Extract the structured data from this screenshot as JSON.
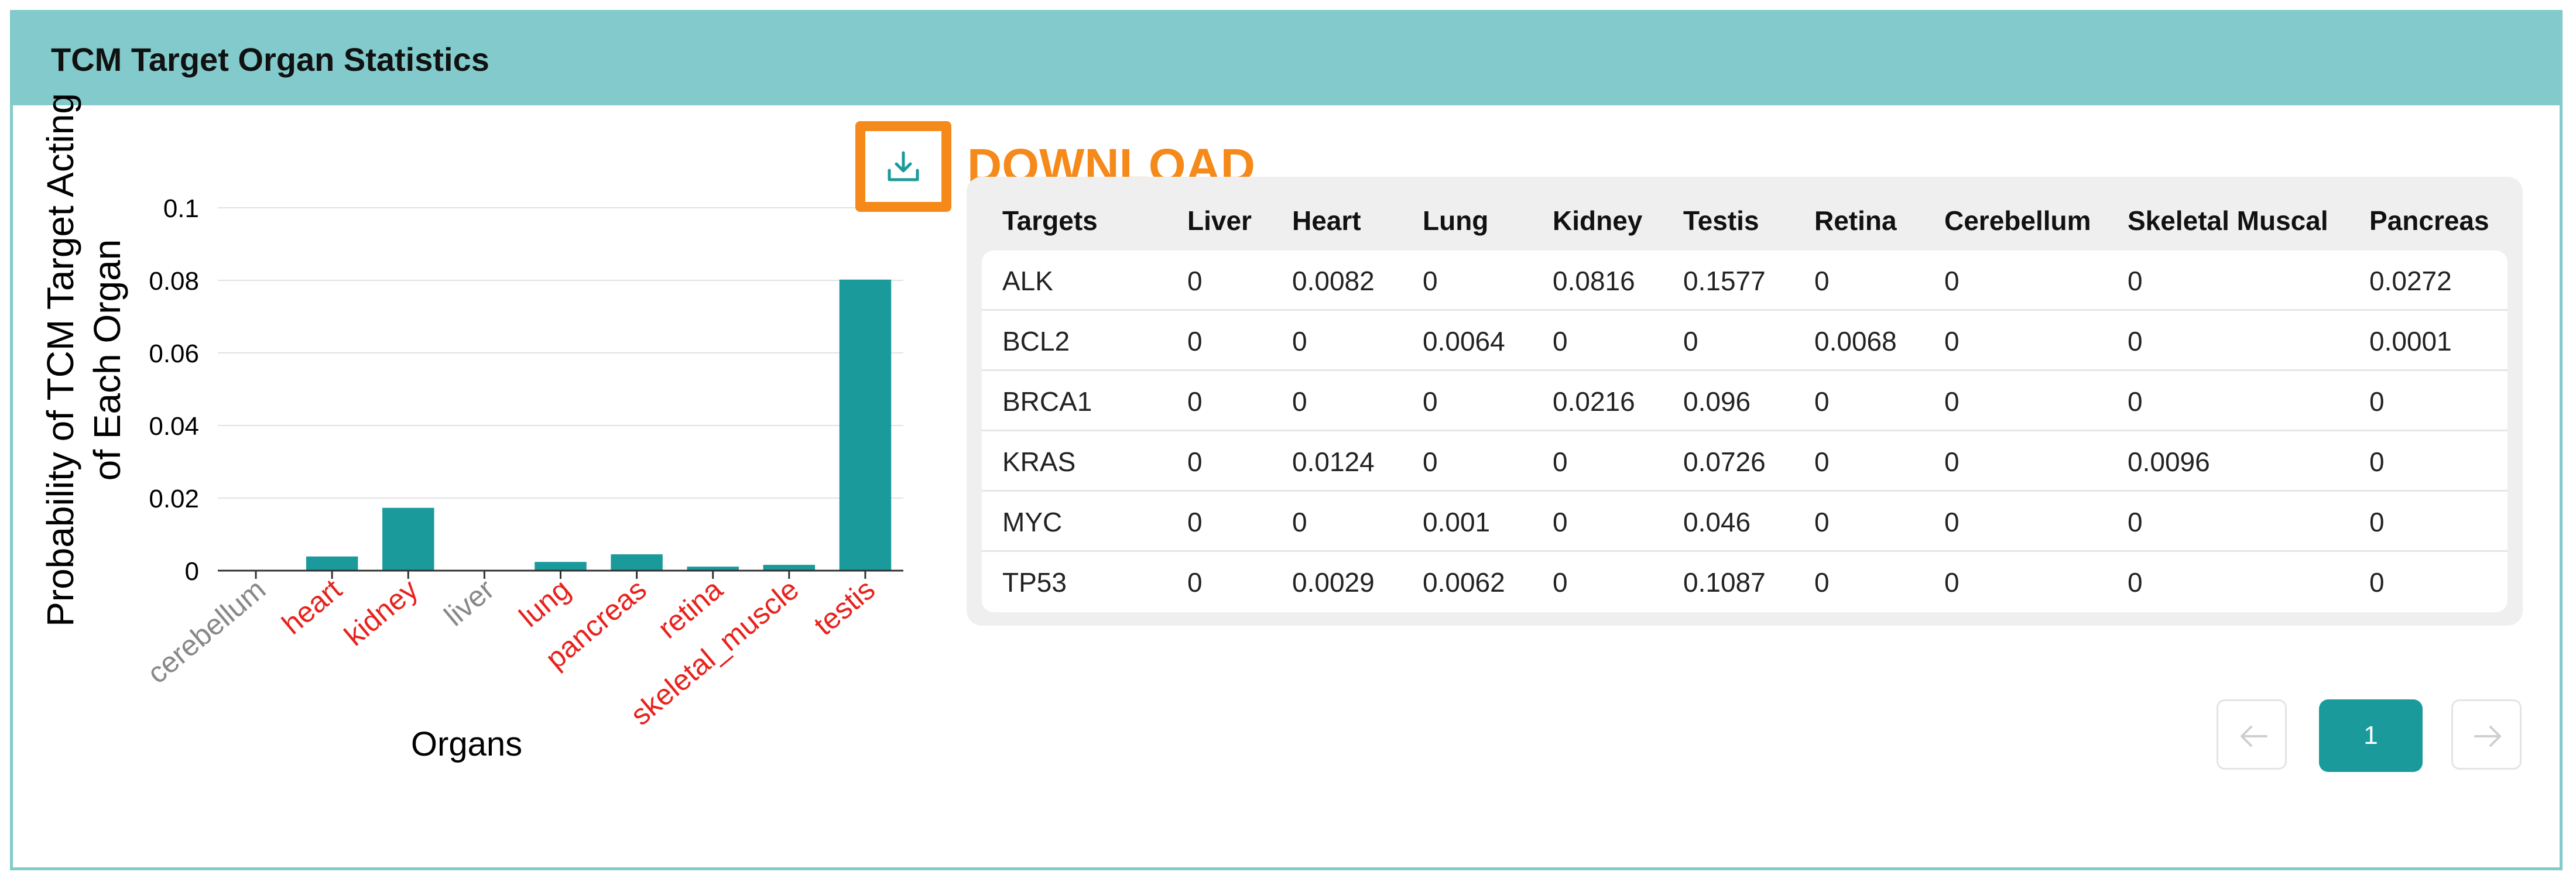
{
  "panel": {
    "title": "TCM Target Organ Statistics"
  },
  "toolbar": {
    "download_label": "DOWNLOAD",
    "download_icon": "download-icon",
    "accent_color": "#f5891a"
  },
  "chart_data": {
    "type": "bar",
    "title": "",
    "xlabel": "Organs",
    "ylabel": "Probability of TCM Target Acting\nof Each Organ",
    "ylabel_lines": [
      "Probability of TCM Target Acting",
      "of Each Organ"
    ],
    "categories": [
      "cerebellum",
      "heart",
      "kidney",
      "liver",
      "lung",
      "pancreas",
      "retina",
      "skeletal_muscle",
      "testis"
    ],
    "category_colors": [
      "#888888",
      "#e8221d",
      "#e8221d",
      "#888888",
      "#e8221d",
      "#e8221d",
      "#e8221d",
      "#e8221d",
      "#e8221d"
    ],
    "values": [
      0,
      0.0039,
      0.0173,
      0,
      0.0024,
      0.0045,
      0.0011,
      0.0016,
      0.0802
    ],
    "ylim": [
      0,
      0.1
    ],
    "yticks": [
      0,
      0.02,
      0.04,
      0.06,
      0.08,
      0.1
    ],
    "ytick_labels": [
      "0",
      "0.02",
      "0.04",
      "0.06",
      "0.08",
      "0.1"
    ],
    "bar_color": "#1a9a9b",
    "grid": true
  },
  "table": {
    "columns": [
      "Targets",
      "Liver",
      "Heart",
      "Lung",
      "Kidney",
      "Testis",
      "Retina",
      "Cerebellum",
      "Skeletal Muscal",
      "Pancreas"
    ],
    "rows": [
      [
        "ALK",
        "0",
        "0.0082",
        "0",
        "0.0816",
        "0.1577",
        "0",
        "0",
        "0",
        "0.0272"
      ],
      [
        "BCL2",
        "0",
        "0",
        "0.0064",
        "0",
        "0",
        "0.0068",
        "0",
        "0",
        "0.0001"
      ],
      [
        "BRCA1",
        "0",
        "0",
        "0",
        "0.0216",
        "0.096",
        "0",
        "0",
        "0",
        "0"
      ],
      [
        "KRAS",
        "0",
        "0.0124",
        "0",
        "0",
        "0.0726",
        "0",
        "0",
        "0.0096",
        "0"
      ],
      [
        "MYC",
        "0",
        "0",
        "0.001",
        "0",
        "0.046",
        "0",
        "0",
        "0",
        "0"
      ],
      [
        "TP53",
        "0",
        "0.0029",
        "0.0062",
        "0",
        "0.1087",
        "0",
        "0",
        "0",
        "0"
      ]
    ]
  },
  "pagination": {
    "current_page": "1",
    "prev_icon": "arrow-left-icon",
    "next_icon": "arrow-right-icon"
  }
}
